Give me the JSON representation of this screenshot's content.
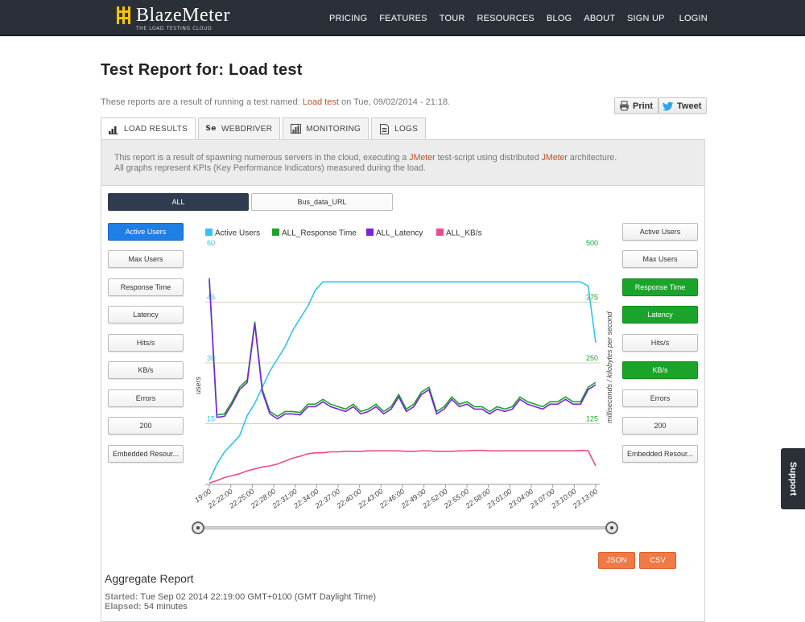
{
  "header": {
    "brand": "BlazeMeter",
    "tagline": "THE LOAD TESTING CLOUD",
    "nav": [
      "PRICING",
      "FEATURES",
      "TOUR",
      "RESOURCES",
      "BLOG",
      "ABOUT"
    ],
    "account": [
      "SIGN UP",
      "LOGIN"
    ],
    "brand_color": "#f5c400"
  },
  "page": {
    "title": "Test Report for: Load test",
    "intro_prefix": "These reports are a result of running a test named:",
    "test_name": "Load test",
    "intro_suffix": "on Tue, 09/02/2014 - 21:18.",
    "print_label": "Print",
    "tweet_label": "Tweet"
  },
  "tabs": [
    {
      "label": "LOAD RESULTS",
      "icon": "bar-chart-icon"
    },
    {
      "label": "WEBDRIVER",
      "icon": "selenium-icon"
    },
    {
      "label": "MONITORING",
      "icon": "monitoring-chart-icon"
    },
    {
      "label": "LOGS",
      "icon": "document-icon"
    }
  ],
  "notice": {
    "part1": "This report is a result of spawning numerous servers in the cloud, executing a",
    "jmeter1": "JMeter",
    "part2": "test-script using distributed",
    "jmeter2": "JMeter",
    "part3": "architecture.",
    "line2": "All graphs represent KPIs (Key Performance Indicators) measured during the load."
  },
  "label_tabs": [
    "ALL",
    "Bus_data_URL"
  ],
  "left_buttons": [
    "Active Users",
    "Max Users",
    "Response Time",
    "Latency",
    "Hits/s",
    "KB/s",
    "Errors",
    "200",
    "Embedded Resour..."
  ],
  "right_buttons": [
    "Active Users",
    "Max Users",
    "Response Time",
    "Latency",
    "Hits/s",
    "KB/s",
    "Errors",
    "200",
    "Embedded Resour..."
  ],
  "chart_data": {
    "type": "line",
    "legend_position": "top",
    "grid": true,
    "y_left_label": "users",
    "y_right_label": "milliseconds / kilobytes per second",
    "y_left_ticks": [
      "15",
      "30",
      "45",
      "60"
    ],
    "y_right_ticks": [
      "125",
      "250",
      "375",
      "500"
    ],
    "y_left_range": [
      0,
      60
    ],
    "y_right_range": [
      0,
      500
    ],
    "x_ticks": [
      "19:00",
      "22:22:00",
      "22:25:00",
      "22:28:00",
      "22:31:00",
      "22:34:00",
      "22:37:00",
      "22:40:00",
      "22:43:00",
      "22:46:00",
      "22:49:00",
      "22:52:00",
      "22:55:00",
      "22:58:00",
      "23:01:00",
      "23:04:00",
      "23:07:00",
      "23:10:00",
      "23:13:00"
    ],
    "series": [
      {
        "name": "Active Users",
        "color": "#2fc4f2",
        "axis": "left",
        "values": [
          1,
          5,
          8,
          10,
          12,
          17,
          20,
          24,
          28,
          31,
          34,
          38,
          41,
          44,
          48,
          50,
          50,
          50,
          50,
          50,
          50,
          50,
          50,
          50,
          50,
          50,
          50,
          50,
          50,
          50,
          50,
          50,
          50,
          50,
          50,
          50,
          50,
          50,
          50,
          50,
          50,
          50,
          50,
          50,
          50,
          50,
          50,
          50,
          50,
          50,
          49,
          35
        ]
      },
      {
        "name": "ALL_Response Time",
        "color": "#1aa52a",
        "axis": "right",
        "values": [
          425,
          143,
          145,
          170,
          200,
          215,
          335,
          195,
          150,
          140,
          150,
          150,
          148,
          165,
          165,
          175,
          165,
          160,
          155,
          165,
          150,
          155,
          165,
          150,
          160,
          185,
          155,
          165,
          190,
          200,
          150,
          160,
          180,
          165,
          170,
          160,
          160,
          150,
          160,
          155,
          160,
          180,
          170,
          165,
          160,
          170,
          170,
          180,
          170,
          170,
          200,
          210
        ]
      },
      {
        "name": "ALL_Latency",
        "color": "#7a22e0",
        "axis": "right",
        "values": [
          420,
          138,
          140,
          165,
          195,
          210,
          330,
          190,
          145,
          135,
          145,
          145,
          143,
          160,
          160,
          170,
          160,
          155,
          150,
          160,
          145,
          150,
          160,
          145,
          155,
          180,
          150,
          160,
          185,
          195,
          145,
          155,
          175,
          160,
          165,
          155,
          155,
          145,
          155,
          150,
          155,
          175,
          165,
          160,
          155,
          165,
          165,
          175,
          165,
          165,
          195,
          205
        ]
      },
      {
        "name": "ALL_KB/s",
        "color": "#f0498f",
        "axis": "right",
        "values": [
          3,
          8,
          14,
          18,
          22,
          28,
          32,
          36,
          38,
          42,
          48,
          54,
          58,
          63,
          65,
          65,
          67,
          67,
          68,
          68,
          68,
          69,
          69,
          69,
          69,
          69,
          68,
          68,
          69,
          69,
          68,
          68,
          68,
          69,
          69,
          70,
          70,
          69,
          69,
          69,
          69,
          69,
          69,
          69,
          69,
          69,
          69,
          69,
          69,
          70,
          69,
          38
        ]
      }
    ]
  },
  "export": {
    "json_label": "JSON",
    "csv_label": "CSV"
  },
  "aggregate": {
    "title": "Aggregate Report",
    "started_label": "Started:",
    "started_value": "Tue Sep 02 2014 22:19:00 GMT+0100 (GMT Daylight Time)",
    "elapsed_label": "Elapsed:",
    "elapsed_value": "54 minutes"
  },
  "support_label": "Support"
}
